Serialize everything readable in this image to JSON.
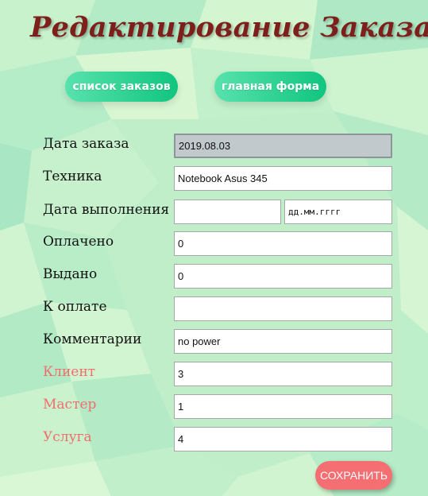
{
  "page": {
    "title": "Редактирование Заказа"
  },
  "nav": {
    "orders_label": "список заказов",
    "main_label": "главная форма"
  },
  "form": {
    "order_date": {
      "label": "Дата заказа",
      "value": "2019.08.03"
    },
    "device": {
      "label": "Техника",
      "value": "Notebook Asus 345"
    },
    "completion_date": {
      "label": "Дата выполнения",
      "time_value": "",
      "date_placeholder": "дд.мм.гггг"
    },
    "paid": {
      "label": "Оплачено",
      "value": "0"
    },
    "issued": {
      "label": "Выдано",
      "value": "0"
    },
    "to_pay": {
      "label": "К оплате",
      "value": ""
    },
    "comments": {
      "label": "Комментарии",
      "value": "no power"
    },
    "client": {
      "label": "Клиент",
      "value": "3"
    },
    "master": {
      "label": "Мастер",
      "value": "1"
    },
    "service": {
      "label": "Услуга",
      "value": "4"
    }
  },
  "actions": {
    "save_label": "СОХРАНИТЬ"
  },
  "colors": {
    "title": "#7d1f1a",
    "nav_button": "#10c57f",
    "highlight_label": "#f26d6d",
    "save_button": "#f56f72",
    "background": "#bfeec9"
  }
}
